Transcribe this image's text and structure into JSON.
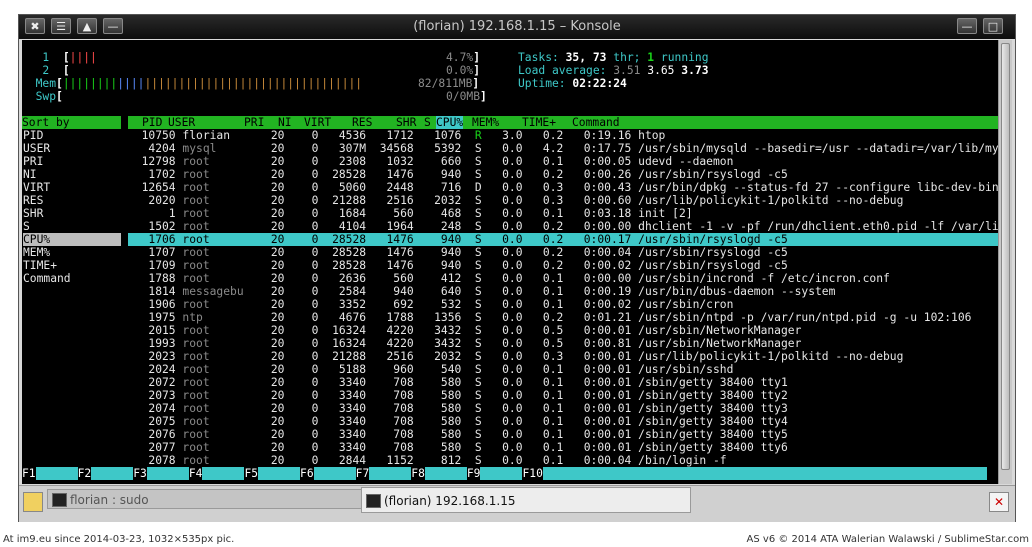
{
  "window": {
    "title": "(florian) 192.168.1.15 – Konsole",
    "buttons": {
      "close": "✖",
      "menu": "☰",
      "shade": "▲",
      "minimize": "—",
      "maximize": "□",
      "close_right": "✕"
    }
  },
  "meters": {
    "cpu1": {
      "label": "1",
      "bar": "||||",
      "value": "4.7%"
    },
    "cpu2": {
      "label": "2",
      "bar": "",
      "value": "0.0%"
    },
    "mem": {
      "label": "Mem",
      "bar_green": "||||||||",
      "bar_blue": "||||",
      "bar_yellow": "||||||||||||||||||||||||||||||||",
      "value": "82/811MB"
    },
    "swp": {
      "label": "Swp",
      "bar": "",
      "value": "0/0MB"
    }
  },
  "stats": {
    "tasks_label": "Tasks:",
    "tasks": "35,",
    "thr_count": "73",
    "thr_label": "thr;",
    "running_count": "1",
    "running_label": "running",
    "load_label": "Load average:",
    "load1": "3.51",
    "load5": "3.65",
    "load15": "3.73",
    "uptime_label": "Uptime:",
    "uptime": "02:22:24"
  },
  "sort_panel": {
    "header": "Sort by",
    "items": [
      "PID",
      "USER",
      "PRI",
      "NI",
      "VIRT",
      "RES",
      "SHR",
      "S",
      "CPU%",
      "MEM%",
      "TIME+",
      "Command"
    ],
    "active_index": 8
  },
  "columns": {
    "pid": "PID",
    "user": "USER",
    "pri": "PRI",
    "ni": "NI",
    "virt": "VIRT",
    "res": "RES",
    "shr": "SHR",
    "s": "S",
    "cpu": "CPU%",
    "mem": "MEM%",
    "time": "TIME+",
    "command": "Command"
  },
  "processes": [
    {
      "pid": "10750",
      "user": "florian",
      "pri": "20",
      "ni": "0",
      "virt": "4536",
      "res": "1712",
      "shr": "1076",
      "s": "R",
      "cpu": "3.0",
      "mem": "0.2",
      "time": "0:19.16",
      "command": "htop"
    },
    {
      "pid": "4204",
      "user": "mysql",
      "pri": "20",
      "ni": "0",
      "virt": "307M",
      "res": "34568",
      "shr": "5392",
      "s": "S",
      "cpu": "0.0",
      "mem": "4.2",
      "time": "0:17.75",
      "command": "/usr/sbin/mysqld --basedir=/usr --datadir=/var/lib/mysql --pl"
    },
    {
      "pid": "12798",
      "user": "root",
      "pri": "20",
      "ni": "0",
      "virt": "2308",
      "res": "1032",
      "shr": "660",
      "s": "S",
      "cpu": "0.0",
      "mem": "0.1",
      "time": "0:00.05",
      "command": "udevd --daemon"
    },
    {
      "pid": "1702",
      "user": "root",
      "pri": "20",
      "ni": "0",
      "virt": "28528",
      "res": "1476",
      "shr": "940",
      "s": "S",
      "cpu": "0.0",
      "mem": "0.2",
      "time": "0:00.26",
      "command": "/usr/sbin/rsyslogd -c5"
    },
    {
      "pid": "12654",
      "user": "root",
      "pri": "20",
      "ni": "0",
      "virt": "5060",
      "res": "2448",
      "shr": "716",
      "s": "D",
      "cpu": "0.0",
      "mem": "0.3",
      "time": "0:00.43",
      "command": "/usr/bin/dpkg --status-fd 27 --configure libc-dev-bin:armhf l"
    },
    {
      "pid": "2020",
      "user": "root",
      "pri": "20",
      "ni": "0",
      "virt": "21288",
      "res": "2516",
      "shr": "2032",
      "s": "S",
      "cpu": "0.0",
      "mem": "0.3",
      "time": "0:00.60",
      "command": "/usr/lib/policykit-1/polkitd --no-debug"
    },
    {
      "pid": "1",
      "user": "root",
      "pri": "20",
      "ni": "0",
      "virt": "1684",
      "res": "560",
      "shr": "468",
      "s": "S",
      "cpu": "0.0",
      "mem": "0.1",
      "time": "0:03.18",
      "command": "init [2]"
    },
    {
      "pid": "1502",
      "user": "root",
      "pri": "20",
      "ni": "0",
      "virt": "4104",
      "res": "1964",
      "shr": "248",
      "s": "S",
      "cpu": "0.0",
      "mem": "0.2",
      "time": "0:00.00",
      "command": "dhclient -1 -v -pf /run/dhclient.eth0.pid -lf /var/lib/dhcp/d"
    },
    {
      "pid": "1706",
      "user": "root",
      "pri": "20",
      "ni": "0",
      "virt": "28528",
      "res": "1476",
      "shr": "940",
      "s": "S",
      "cpu": "0.0",
      "mem": "0.2",
      "time": "0:00.17",
      "command": "/usr/sbin/rsyslogd -c5"
    },
    {
      "pid": "1707",
      "user": "root",
      "pri": "20",
      "ni": "0",
      "virt": "28528",
      "res": "1476",
      "shr": "940",
      "s": "S",
      "cpu": "0.0",
      "mem": "0.2",
      "time": "0:00.04",
      "command": "/usr/sbin/rsyslogd -c5"
    },
    {
      "pid": "1709",
      "user": "root",
      "pri": "20",
      "ni": "0",
      "virt": "28528",
      "res": "1476",
      "shr": "940",
      "s": "S",
      "cpu": "0.0",
      "mem": "0.2",
      "time": "0:00.02",
      "command": "/usr/sbin/rsyslogd -c5"
    },
    {
      "pid": "1788",
      "user": "root",
      "pri": "20",
      "ni": "0",
      "virt": "2636",
      "res": "560",
      "shr": "412",
      "s": "S",
      "cpu": "0.0",
      "mem": "0.1",
      "time": "0:00.00",
      "command": "/usr/sbin/incrond -f /etc/incron.conf"
    },
    {
      "pid": "1814",
      "user": "messagebu",
      "pri": "20",
      "ni": "0",
      "virt": "2584",
      "res": "940",
      "shr": "640",
      "s": "S",
      "cpu": "0.0",
      "mem": "0.1",
      "time": "0:00.19",
      "command": "/usr/bin/dbus-daemon --system"
    },
    {
      "pid": "1906",
      "user": "root",
      "pri": "20",
      "ni": "0",
      "virt": "3352",
      "res": "692",
      "shr": "532",
      "s": "S",
      "cpu": "0.0",
      "mem": "0.1",
      "time": "0:00.02",
      "command": "/usr/sbin/cron"
    },
    {
      "pid": "1975",
      "user": "ntp",
      "pri": "20",
      "ni": "0",
      "virt": "4676",
      "res": "1788",
      "shr": "1356",
      "s": "S",
      "cpu": "0.0",
      "mem": "0.2",
      "time": "0:01.21",
      "command": "/usr/sbin/ntpd -p /var/run/ntpd.pid -g -u 102:106"
    },
    {
      "pid": "2015",
      "user": "root",
      "pri": "20",
      "ni": "0",
      "virt": "16324",
      "res": "4220",
      "shr": "3432",
      "s": "S",
      "cpu": "0.0",
      "mem": "0.5",
      "time": "0:00.01",
      "command": "/usr/sbin/NetworkManager"
    },
    {
      "pid": "1993",
      "user": "root",
      "pri": "20",
      "ni": "0",
      "virt": "16324",
      "res": "4220",
      "shr": "3432",
      "s": "S",
      "cpu": "0.0",
      "mem": "0.5",
      "time": "0:00.81",
      "command": "/usr/sbin/NetworkManager"
    },
    {
      "pid": "2023",
      "user": "root",
      "pri": "20",
      "ni": "0",
      "virt": "21288",
      "res": "2516",
      "shr": "2032",
      "s": "S",
      "cpu": "0.0",
      "mem": "0.3",
      "time": "0:00.01",
      "command": "/usr/lib/policykit-1/polkitd --no-debug"
    },
    {
      "pid": "2024",
      "user": "root",
      "pri": "20",
      "ni": "0",
      "virt": "5188",
      "res": "960",
      "shr": "540",
      "s": "S",
      "cpu": "0.0",
      "mem": "0.1",
      "time": "0:00.01",
      "command": "/usr/sbin/sshd"
    },
    {
      "pid": "2072",
      "user": "root",
      "pri": "20",
      "ni": "0",
      "virt": "3340",
      "res": "708",
      "shr": "580",
      "s": "S",
      "cpu": "0.0",
      "mem": "0.1",
      "time": "0:00.01",
      "command": "/sbin/getty 38400 tty1"
    },
    {
      "pid": "2073",
      "user": "root",
      "pri": "20",
      "ni": "0",
      "virt": "3340",
      "res": "708",
      "shr": "580",
      "s": "S",
      "cpu": "0.0",
      "mem": "0.1",
      "time": "0:00.01",
      "command": "/sbin/getty 38400 tty2"
    },
    {
      "pid": "2074",
      "user": "root",
      "pri": "20",
      "ni": "0",
      "virt": "3340",
      "res": "708",
      "shr": "580",
      "s": "S",
      "cpu": "0.0",
      "mem": "0.1",
      "time": "0:00.01",
      "command": "/sbin/getty 38400 tty3"
    },
    {
      "pid": "2075",
      "user": "root",
      "pri": "20",
      "ni": "0",
      "virt": "3340",
      "res": "708",
      "shr": "580",
      "s": "S",
      "cpu": "0.0",
      "mem": "0.1",
      "time": "0:00.01",
      "command": "/sbin/getty 38400 tty4"
    },
    {
      "pid": "2076",
      "user": "root",
      "pri": "20",
      "ni": "0",
      "virt": "3340",
      "res": "708",
      "shr": "580",
      "s": "S",
      "cpu": "0.0",
      "mem": "0.1",
      "time": "0:00.01",
      "command": "/sbin/getty 38400 tty5"
    },
    {
      "pid": "2077",
      "user": "root",
      "pri": "20",
      "ni": "0",
      "virt": "3340",
      "res": "708",
      "shr": "580",
      "s": "S",
      "cpu": "0.0",
      "mem": "0.1",
      "time": "0:00.01",
      "command": "/sbin/getty 38400 tty6"
    },
    {
      "pid": "2078",
      "user": "root",
      "pri": "20",
      "ni": "0",
      "virt": "2844",
      "res": "1152",
      "shr": "812",
      "s": "S",
      "cpu": "0.0",
      "mem": "0.1",
      "time": "0:00.04",
      "command": "/bin/login -f"
    }
  ],
  "selected_row_index": 8,
  "fkeys": [
    "F1",
    "F2",
    "F3",
    "F4",
    "F5",
    "F6",
    "F7",
    "F8",
    "F9",
    "F10"
  ],
  "tabs": [
    {
      "label": "florian : sudo",
      "active": false
    },
    {
      "label": "(florian) 192.168.1.15",
      "active": true
    }
  ],
  "footer": {
    "left": "At im9.eu  since 2014-03-23, 1032×535px pic.",
    "right": "AS v6 © 2014 ATA Walerian Walawski / SublimeStar.com"
  },
  "colors": {
    "terminal_bg": "#000000",
    "header_green": "#22b422",
    "selection_cyan": "#3ec8c8",
    "meter_green": "#19d219",
    "meter_red": "#ff4b4b"
  }
}
